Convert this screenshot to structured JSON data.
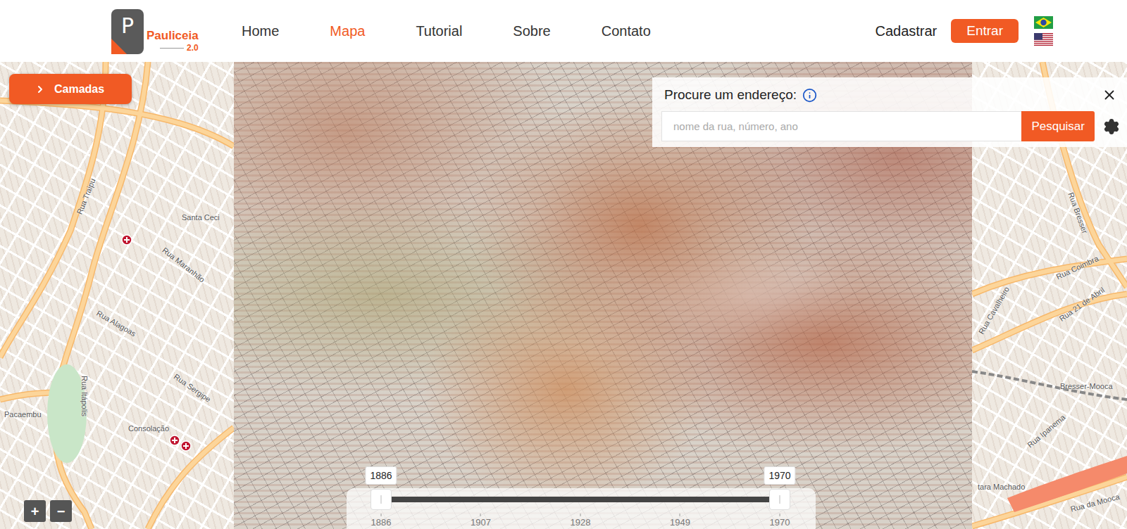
{
  "header": {
    "logo": {
      "letter": "P",
      "name": "Pauliceia",
      "version": "2.0"
    },
    "nav": [
      {
        "label": "Home",
        "selected": false
      },
      {
        "label": "Mapa",
        "selected": true
      },
      {
        "label": "Tutorial",
        "selected": false
      },
      {
        "label": "Sobre",
        "selected": false
      },
      {
        "label": "Contato",
        "selected": false
      }
    ],
    "signup": "Cadastrar",
    "login": "Entrar"
  },
  "layers_button": {
    "label": "Camadas",
    "expanded": false
  },
  "search": {
    "title": "Procure um endereço:",
    "placeholder": "nome da rua, número, ano",
    "button": "Pesquisar"
  },
  "timeline": {
    "from": "1886",
    "to": "1970",
    "from_level": 0,
    "to_level": 1,
    "ticks": [
      "1886",
      "1907",
      "1928",
      "1949",
      "1970"
    ]
  },
  "zoom": {
    "in": "+",
    "out": "−"
  },
  "map": {
    "labels": [
      "Rua Traipu",
      "Santa Ceci",
      "Rua Maranhão",
      "Rua Alagoas",
      "Rua Itápolis",
      "Pacaembu",
      "Consolação",
      "Rua Sergipe",
      "Rua Bresser",
      "Rua Coimbra",
      "Rua 21 de Abril",
      "Rua Cavalheiro",
      "Bresser-Mooca",
      "Rua Ipanema",
      "Rua da Mooca",
      "tara Machado"
    ],
    "pins": [
      {
        "kind": "hospital"
      },
      {
        "kind": "hospital"
      },
      {
        "kind": "hospital"
      }
    ]
  }
}
